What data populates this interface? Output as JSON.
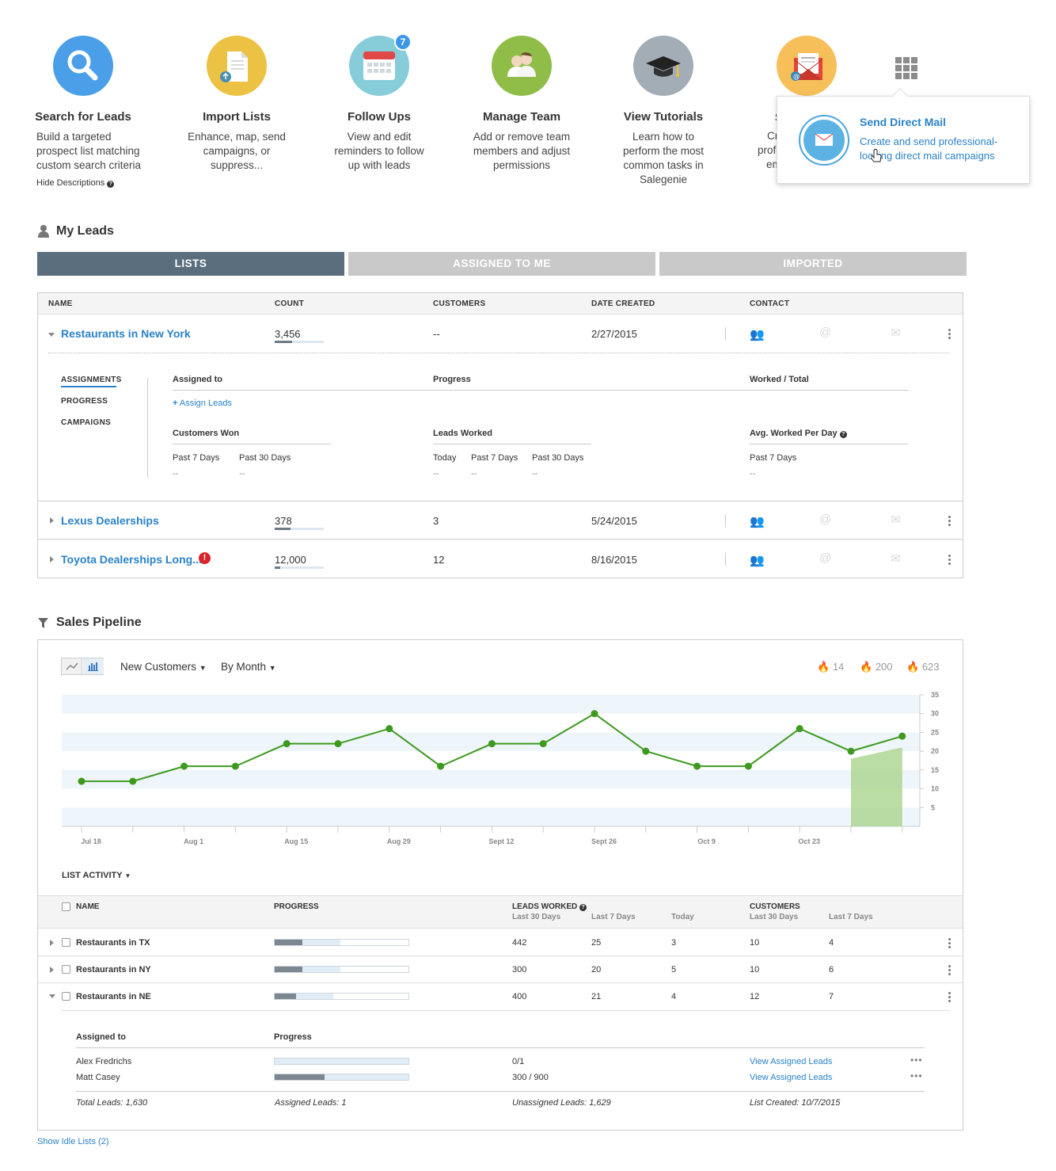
{
  "hub": [
    {
      "title": "Search for Leads",
      "desc": "Build a targeted prospect list matching custom search criteria",
      "icon": "magnifier-icon",
      "color": "#4a9fe8"
    },
    {
      "title": "Import Lists",
      "desc": "Enhance, map, send campaigns, or suppress...",
      "icon": "document-upload-icon",
      "color": "#ecc244"
    },
    {
      "title": "Follow Ups",
      "desc": "View and edit reminders to follow up with leads",
      "icon": "calendar-icon",
      "color": "#87ccd9",
      "badge": "7"
    },
    {
      "title": "Manage Team",
      "desc": "Add or remove team members and adjust permissions",
      "icon": "team-people-icon",
      "color": "#8fbd47"
    },
    {
      "title": "View Tutorials",
      "desc": "Learn how to perform the most common tasks in Salegenie",
      "icon": "graduation-cap-icon",
      "color": "#a3adb6"
    }
  ],
  "hub_partial": {
    "title_fragment": "S",
    "desc_fragments": [
      "Cr",
      "profe",
      "em"
    ]
  },
  "hide_descriptions": "Hide Descriptions",
  "popover": {
    "title": "Send Direct Mail",
    "desc": "Create and send professional-looking direct mail campaigns"
  },
  "my_leads": {
    "title": "My Leads",
    "tabs": [
      "LISTS",
      "ASSIGNED TO ME",
      "IMPORTED"
    ],
    "headers": [
      "NAME",
      "COUNT",
      "CUSTOMERS",
      "DATE CREATED",
      "CONTACT"
    ],
    "rows": [
      {
        "name": "Restaurants in New York",
        "count": "3,456",
        "count_fill": 0.35,
        "customers": "--",
        "date": "2/27/2015"
      },
      {
        "name": "Lexus Dealerships",
        "count": "378",
        "count_fill": 0.33,
        "customers": "3",
        "date": "5/24/2015"
      },
      {
        "name": "Toyota Dealerships Long...",
        "count": "12,000",
        "count_fill": 0.12,
        "customers": "12",
        "date": "8/16/2015",
        "alert": "!"
      }
    ],
    "detail": {
      "side_tabs": [
        "ASSIGNMENTS",
        "PROGRESS",
        "CAMPAIGNS"
      ],
      "assigned_to": "Assigned to",
      "progress": "Progress",
      "worked_total": "Worked / Total",
      "assign_leads": "Assign Leads",
      "customers_won": "Customers Won",
      "leads_worked": "Leads Worked",
      "avg_worked": "Avg. Worked Per Day",
      "past7": "Past 7 Days",
      "past30": "Past 30 Days",
      "today": "Today",
      "past7b": "Past 7  Days",
      "dash": "--"
    }
  },
  "pipeline": {
    "title": "Sales Pipeline",
    "metric": "New Customers",
    "period": "By Month",
    "stats": [
      {
        "icon": "flame-red-icon",
        "value": "14",
        "color": "#d9232a"
      },
      {
        "icon": "flame-orange-icon",
        "value": "200",
        "color": "#f28c1b"
      },
      {
        "icon": "flame-blue-icon",
        "value": "623",
        "color": "#4f86d9"
      }
    ]
  },
  "chart_data": {
    "type": "line",
    "x_ticks": [
      "Jul 18",
      "Aug 1",
      "Aug 15",
      "Aug 29",
      "Sept 12",
      "Sept 26",
      "Oct 9",
      "Oct 23"
    ],
    "series": [
      {
        "values": [
          12,
          12,
          16,
          16,
          22,
          22,
          26,
          16,
          22,
          22,
          30,
          20,
          16,
          16,
          26,
          20,
          24
        ]
      }
    ],
    "projection": {
      "from": 18,
      "to": 21
    },
    "ylim": [
      0,
      35
    ],
    "y_ticks": [
      5,
      10,
      15,
      20,
      25,
      30,
      35
    ],
    "grid": true
  },
  "list_activity": {
    "title": "LIST ACTIVITY",
    "headers": {
      "name": "NAME",
      "progress": "PROGRESS",
      "leads_worked": "LEADS WORKED",
      "last30": "Last 30 Days",
      "last7": "Last 7 Days",
      "today": "Today",
      "customers": "CUSTOMERS",
      "c_last30": "Last 30 Days",
      "c_last7": "Last 7 Days"
    },
    "rows": [
      {
        "name": "Restaurants in TX",
        "p_dark": 0.21,
        "p_light": 0.49,
        "lw30": "442",
        "lw7": "25",
        "lwt": "3",
        "c30": "10",
        "c7": "4"
      },
      {
        "name": "Restaurants in NY",
        "p_dark": 0.21,
        "p_light": 0.49,
        "lw30": "300",
        "lw7": "20",
        "lwt": "5",
        "c30": "10",
        "c7": "6"
      },
      {
        "name": "Restaurants in NE",
        "p_dark": 0.16,
        "p_light": 0.44,
        "lw30": "400",
        "lw7": "21",
        "lwt": "4",
        "c30": "12",
        "c7": "7"
      }
    ],
    "detail": {
      "assigned_to": "Assigned to",
      "progress": "Progress",
      "people": [
        {
          "name": "Alex Fredrichs",
          "p_dark": 0,
          "value": "0/1",
          "link": "View Assigned Leads"
        },
        {
          "name": "Matt Casey",
          "p_dark": 0.37,
          "value": "300 / 900",
          "link": "View Assigned Leads"
        }
      ],
      "total_leads": "Total Leads: 1,630",
      "assigned_leads": "Assigned Leads: 1",
      "unassigned_leads": "Unassigned Leads: 1,629",
      "list_created": "List Created: 10/7/2015"
    }
  },
  "show_idle": "Show Idle Lists (2)"
}
